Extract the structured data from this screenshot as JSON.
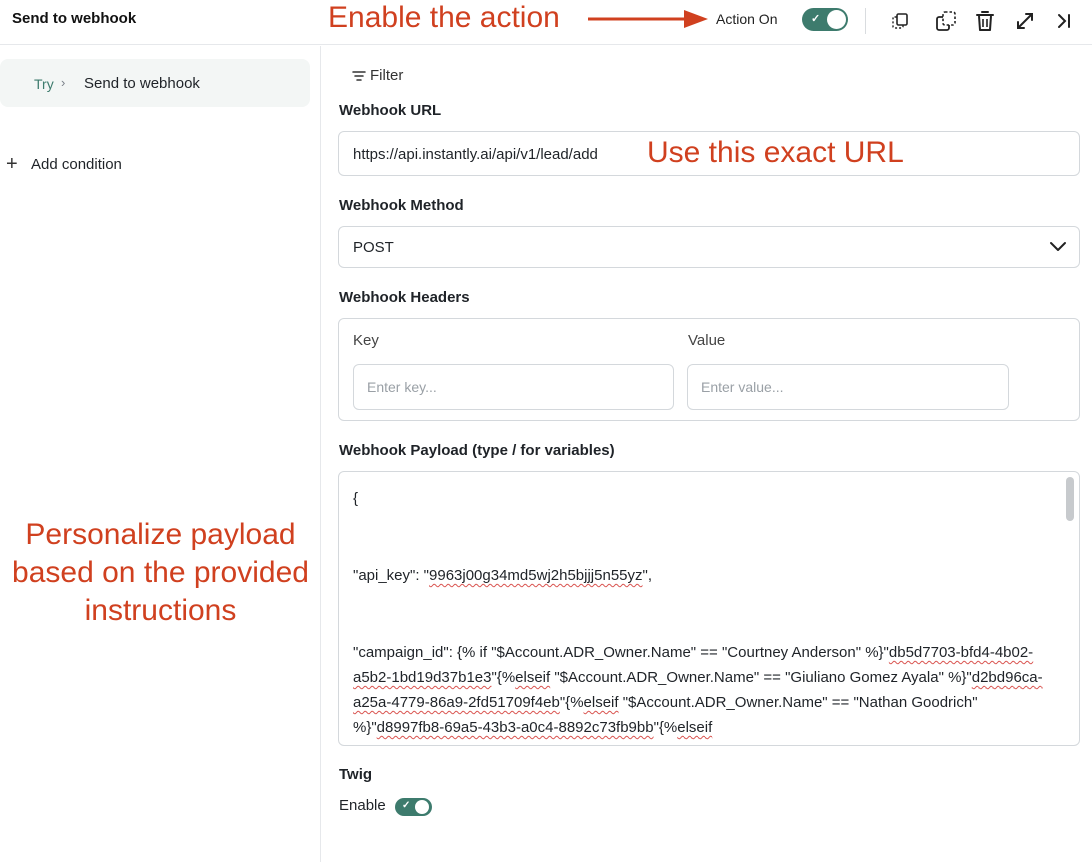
{
  "header": {
    "title": "Send to webhook",
    "action_label": "Action On",
    "action_enabled": true
  },
  "annotations": {
    "enable": "Enable the action",
    "url": "Use this exact URL",
    "personalize": "Personalize payload based on the provided instructions"
  },
  "sidebar": {
    "breadcrumb_root": "Try",
    "breadcrumb_current": "Send to webhook",
    "add_condition": "Add condition"
  },
  "filter_label": "Filter",
  "webhook_url": {
    "label": "Webhook URL",
    "value": "https://api.instantly.ai/api/v1/lead/add"
  },
  "webhook_method": {
    "label": "Webhook Method",
    "value": "POST"
  },
  "webhook_headers": {
    "label": "Webhook Headers",
    "key_label": "Key",
    "value_label": "Value",
    "key_placeholder": "Enter key...",
    "value_placeholder": "Enter value..."
  },
  "payload": {
    "label": "Webhook Payload (type / for variables)",
    "line_open": "{",
    "api_key_prefix": "\"api_key\": \"",
    "api_key_value": "9963j00g34md5wj2h5bjjj5n55yz",
    "api_key_suffix": "\",",
    "campaign_prefix": "\"campaign_id\": {% if \"$Account.ADR_Owner.Name\" == \"Courtney Anderson\" %}\"",
    "id_1": "db5d7703-bfd4-4b02-a5b2-1bd19d37b1e3",
    "seg_1": "\"{%",
    "elseif_1": "elseif",
    "seg_2": " \"$Account.ADR_Owner.Name\" == \"Giuliano Gomez Ayala\" %}\"",
    "id_2": "d2bd96ca-a25a-4779-86a9-2fd51709f4eb",
    "seg_3": "\"{%",
    "elseif_2": "elseif",
    "seg_4": " \"$Account.ADR_Owner.Name\" == \"Nathan Goodrich\" %}\"",
    "id_3": "d8997fb8-69a5-43b3-a0c4-8892c73fb9bb",
    "seg_5": "\"{%",
    "elseif_3": "elseif"
  },
  "twig": {
    "label": "Twig",
    "enable_label": "Enable",
    "enabled": true
  },
  "colors": {
    "accent": "#3d7b6d",
    "annotation": "#d0401f"
  },
  "icons": [
    "duplicate-icon",
    "copy-icon",
    "trash-icon",
    "expand-icon",
    "collapse-panel-icon",
    "filter-icon",
    "plus-icon",
    "chevron-down-icon",
    "chevron-right-icon"
  ]
}
